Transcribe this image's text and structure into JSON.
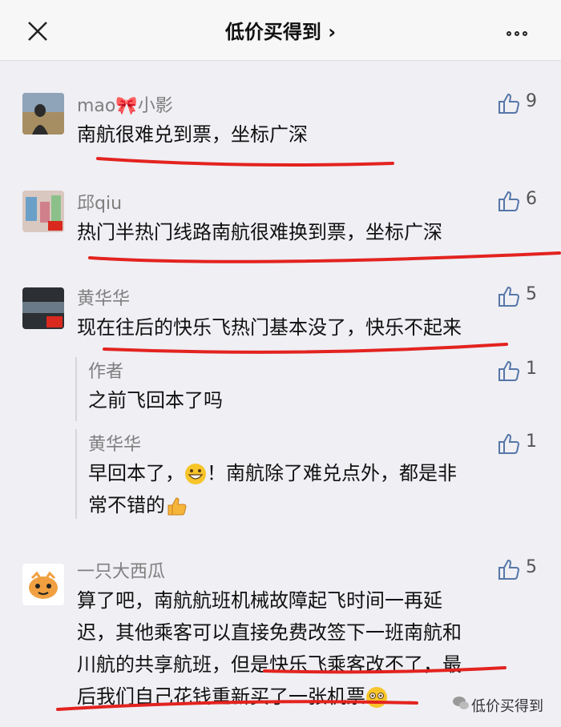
{
  "header": {
    "title": "低价买得到 ›",
    "close_icon": "close-icon",
    "more_icon": "more-icon"
  },
  "comments": [
    {
      "name": "mao🎀小影",
      "text": "南航很难兑到票，坐标广深",
      "likes": "9"
    },
    {
      "name": "邱qiu",
      "text": "热门半热门线路南航很难换到票，坐标广深",
      "likes": "6"
    },
    {
      "name": "黄华华",
      "text": "现在往后的快乐飞热门基本没了，快乐不起来",
      "likes": "5",
      "replies": [
        {
          "name": "作者",
          "text": "之前飞回本了吗",
          "likes": "1"
        },
        {
          "name": "黄华华",
          "text_a": "早回本了，",
          "text_b": "！南航除了难兑点外，都是非",
          "text_c": "常不错的",
          "likes": "1"
        }
      ]
    },
    {
      "name": "一只大西瓜",
      "lines": [
        "算了吧，南航航班机械故障起飞时间一再延",
        "迟，其他乘客可以直接免费改签下一班南航和",
        "川航的共享航班，但是快乐飞乘客改不了，最",
        "后我们自己花钱重新买了一张机票"
      ],
      "likes": "5"
    }
  ],
  "watermark": "低价买得到",
  "colors": {
    "underline": "#e3231f",
    "like_icon": "#5677a8"
  }
}
